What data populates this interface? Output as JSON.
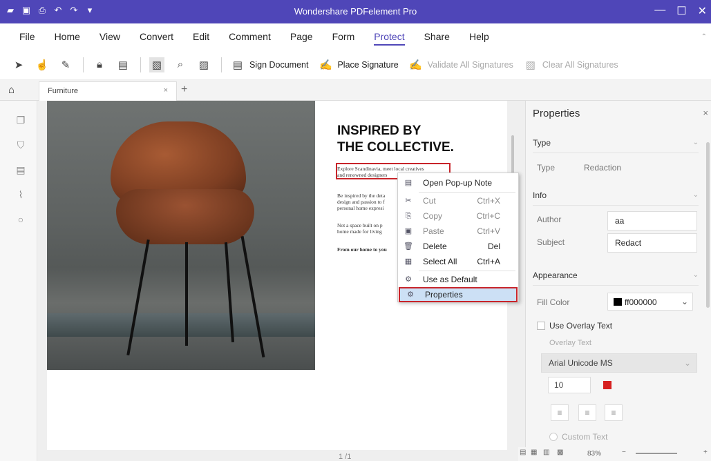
{
  "titlebar": {
    "title": "Wondershare PDFelement Pro",
    "color": "#4f46b8"
  },
  "quick_access": [
    "app-menu-icon",
    "save-icon",
    "print-icon",
    "undo-icon",
    "redo-icon",
    "customize-icon"
  ],
  "window_controls": {
    "minimize": "—",
    "maximize": "☐",
    "close": "✕"
  },
  "menu": {
    "items": [
      "File",
      "Home",
      "View",
      "Convert",
      "Edit",
      "Comment",
      "Page",
      "Form",
      "Protect",
      "Share",
      "Help"
    ],
    "active": "Protect"
  },
  "toolbar": {
    "sign_document": "Sign Document",
    "place_signature": "Place Signature",
    "validate_all": "Validate All Signatures",
    "clear_all": "Clear All Signatures"
  },
  "tabs": {
    "doc_tab": "Furniture",
    "close": "×",
    "add": "+"
  },
  "document": {
    "heading1": "INSPIRED BY",
    "heading2": "THE COLLECTIVE.",
    "para1_l1": "Explore Scandinavia, meet local creatives",
    "para1_l2": "and renowned designers",
    "para2_l1": "Be inspired by the deta",
    "para2_l2": "design and passion to f",
    "para2_l3": "personal home expresi",
    "para3_l1": "Not a space built on p",
    "para3_l2": "home made for living",
    "para4_l1": "From our home to you"
  },
  "pager": {
    "text": "1 /1"
  },
  "context_menu": {
    "open_popup": "Open Pop-up Note",
    "cut": "Cut",
    "cut_sc": "Ctrl+X",
    "copy": "Copy",
    "copy_sc": "Ctrl+C",
    "paste": "Paste",
    "paste_sc": "Ctrl+V",
    "delete": "Delete",
    "delete_sc": "Del",
    "select_all": "Select All",
    "select_all_sc": "Ctrl+A",
    "use_default": "Use as Default",
    "properties": "Properties"
  },
  "properties": {
    "header": "Properties",
    "type_section": "Type",
    "type_label": "Type",
    "type_value": "Redaction",
    "info_section": "Info",
    "author_label": "Author",
    "author_value": "aa",
    "subject_label": "Subject",
    "subject_value": "Redact",
    "appearance_section": "Appearance",
    "fill_color_label": "Fill Color",
    "fill_color_value": "ff000000",
    "use_overlay_text": "Use Overlay Text",
    "overlay_text_label": "Overlay Text",
    "font_value": "Arial Unicode MS",
    "font_size": "10",
    "text_color": "#d62020",
    "custom_text": "Custom Text"
  },
  "statusbar": {
    "zoom": "83%"
  }
}
